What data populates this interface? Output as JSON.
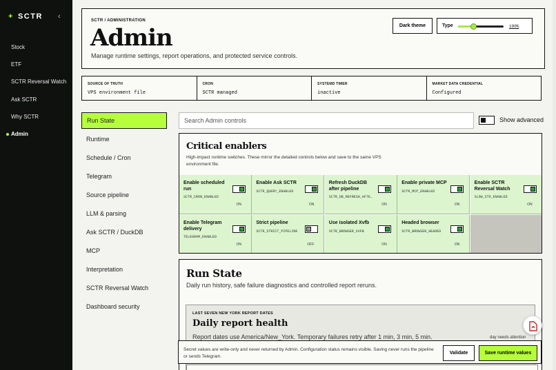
{
  "sidebar": {
    "brand": "SCTR",
    "brand_mark": "+",
    "collapse": "‹",
    "items": [
      {
        "label": "Stock"
      },
      {
        "label": "ETF"
      },
      {
        "label": "SCTR Reversal Watch"
      },
      {
        "label": "Ask SCTR"
      },
      {
        "label": "Why SCTR"
      },
      {
        "label": "Admin"
      }
    ],
    "active_index": 5
  },
  "header": {
    "breadcrumb": "SCTR / ADMINISTRATION",
    "title": "Admin",
    "subtitle": "Manage runtime settings, report operations, and protected service controls.",
    "dark_theme_label": "Dark theme",
    "type_label": "Type",
    "type_value": "100%",
    "type_level": 0.35
  },
  "stats": [
    {
      "key": "SOURCE OF TRUTH",
      "value": "VPS environment file"
    },
    {
      "key": "CRON",
      "value": "SCTR managed"
    },
    {
      "key": "SYSTEMD TIMER",
      "value": "inactive"
    },
    {
      "key": "MARKET DATA CREDENTIAL",
      "value": "Configured"
    }
  ],
  "tabs": [
    {
      "label": "Run State"
    },
    {
      "label": "Runtime"
    },
    {
      "label": "Schedule / Cron"
    },
    {
      "label": "Telegram"
    },
    {
      "label": "Source pipeline"
    },
    {
      "label": "LLM & parsing"
    },
    {
      "label": "Ask SCTR / DuckDB"
    },
    {
      "label": "MCP"
    },
    {
      "label": "Interpretation"
    },
    {
      "label": "SCTR Reversal Watch"
    },
    {
      "label": "Dashboard security"
    }
  ],
  "search": {
    "placeholder": "Search Admin controls"
  },
  "show_advanced_label": "Show advanced",
  "critical": {
    "title": "Critical enablers",
    "description": "High-impact runtime switches. These mirror the detailed controls below and save to the same VPS environment file.",
    "toggles": [
      {
        "label": "Enable scheduled run",
        "config": "SCTR_CRON_ENABLED",
        "state": "ON"
      },
      {
        "label": "Enable Ask SCTR",
        "config": "SCTR_QUERY_ENABLED",
        "state": "ON"
      },
      {
        "label": "Refresh DuckDB after pipeline",
        "config": "SCTR_DB_REFRESH_AFTE…",
        "state": "ON"
      },
      {
        "label": "Enable private MCP",
        "config": "SCTR_MCP_ENABLED",
        "state": "ON"
      },
      {
        "label": "Enable SCTR Reversal Watch",
        "config": "SLOW_STO_ENABLED",
        "state": "ON"
      },
      {
        "label": "Enable Telegram delivery",
        "config": "TELEGRAM_ENABLED",
        "state": "ON"
      },
      {
        "label": "Strict pipeline",
        "config": "SCTR_STRICT_PIPELINE",
        "state": "OFF"
      },
      {
        "label": "Use isolated Xvfb",
        "config": "SCTR_BROWSER_XVFB",
        "state": "ON"
      },
      {
        "label": "Headed browser",
        "config": "SCTR_BROWSER_HEADED",
        "state": "ON"
      }
    ]
  },
  "run_state": {
    "title": "Run State",
    "description": "Daily run history, safe failure diagnostics and controlled report reruns.",
    "health_kicker": "LAST SEVEN NEW YORK REPORT DATES",
    "health_title": "Daily report health",
    "health_desc": "Report dates use America/New_York. Temporary failures retry after 1 min, 3 min, 5 min.",
    "attention": "day needs attention"
  },
  "footer": {
    "note": "Secret values are write-only and never returned by Admin. Configuration status remains visible. Saving never runs the pipeline or sends Telegram.",
    "validate_label": "Validate",
    "save_label": "Save runtime values"
  },
  "colors": {
    "accent": "#b6ff3b",
    "sidebar": "#0f110f",
    "on_cell": "#dcf5cf",
    "switch_on": "#2f9a3a"
  },
  "icons": {
    "pdf": "pdf-icon"
  }
}
